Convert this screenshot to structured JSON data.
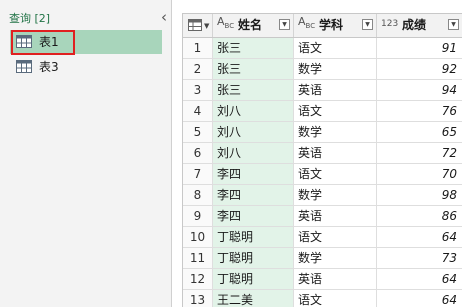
{
  "query_pane": {
    "header": "查询 [2]",
    "collapse_glyph": "‹",
    "items": [
      {
        "label": "表1",
        "selected": true,
        "icon": "table-icon"
      },
      {
        "label": "表3",
        "selected": false,
        "icon": "table-icon"
      }
    ]
  },
  "grid": {
    "columns": [
      {
        "type_icon": "ABC",
        "label": "姓名"
      },
      {
        "type_icon": "ABC",
        "label": "学科"
      },
      {
        "type_icon": "123",
        "label": "成绩"
      }
    ],
    "rows": [
      {
        "idx": "1",
        "name": "张三",
        "subject": "语文",
        "score": "91"
      },
      {
        "idx": "2",
        "name": "张三",
        "subject": "数学",
        "score": "92"
      },
      {
        "idx": "3",
        "name": "张三",
        "subject": "英语",
        "score": "94"
      },
      {
        "idx": "4",
        "name": "刘八",
        "subject": "语文",
        "score": "76"
      },
      {
        "idx": "5",
        "name": "刘八",
        "subject": "数学",
        "score": "65"
      },
      {
        "idx": "6",
        "name": "刘八",
        "subject": "英语",
        "score": "72"
      },
      {
        "idx": "7",
        "name": "李四",
        "subject": "语文",
        "score": "70"
      },
      {
        "idx": "8",
        "name": "李四",
        "subject": "数学",
        "score": "98"
      },
      {
        "idx": "9",
        "name": "李四",
        "subject": "英语",
        "score": "86"
      },
      {
        "idx": "10",
        "name": "丁聪明",
        "subject": "语文",
        "score": "64"
      },
      {
        "idx": "11",
        "name": "丁聪明",
        "subject": "数学",
        "score": "73"
      },
      {
        "idx": "12",
        "name": "丁聪明",
        "subject": "英语",
        "score": "64"
      },
      {
        "idx": "13",
        "name": "王二美",
        "subject": "语文",
        "score": "64"
      }
    ]
  },
  "colors": {
    "selected_bg": "#a8d5bb",
    "highlight_border": "#e02020",
    "name_col_bg": "#e2f3e8",
    "accent": "#217346"
  }
}
